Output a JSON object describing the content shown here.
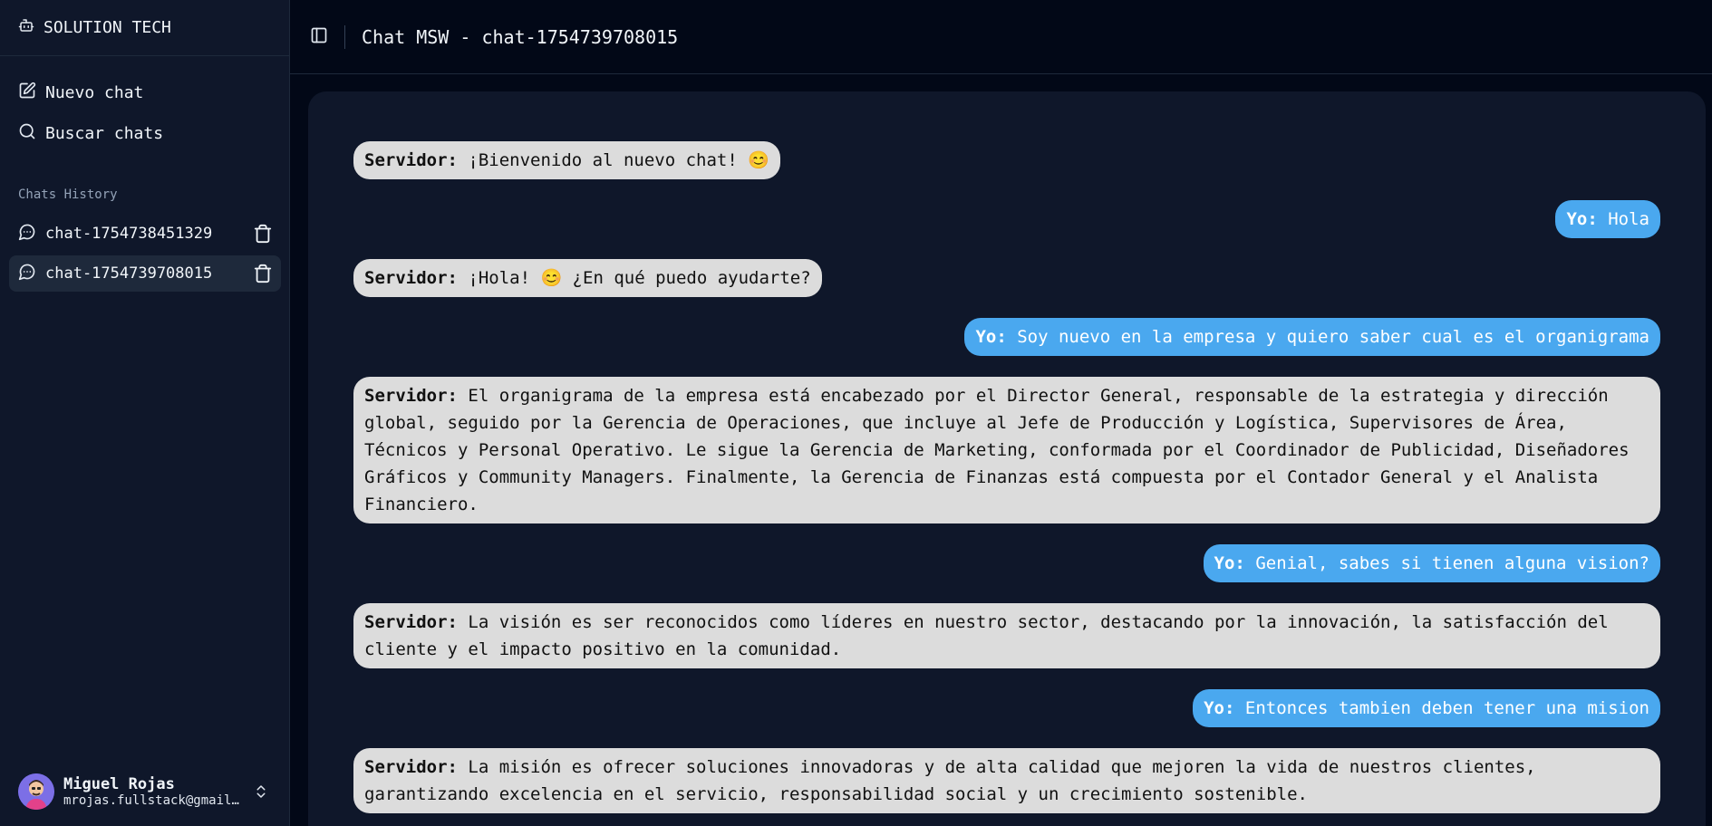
{
  "brand": {
    "name": "SOLUTION TECH",
    "icon": "bot-icon"
  },
  "nav": {
    "new_chat": "Nuevo chat",
    "search_chats": "Buscar chats"
  },
  "history": {
    "label": "Chats History",
    "items": [
      {
        "label": "chat-1754738451329",
        "active": false
      },
      {
        "label": "chat-1754739708015",
        "active": true
      }
    ]
  },
  "user": {
    "name": "Miguel Rojas",
    "email": "mrojas.fullstack@gmail.com"
  },
  "header": {
    "title": "Chat MSW - chat-1754739708015"
  },
  "messages": [
    {
      "from": "server",
      "speaker": "Servidor:",
      "text": " ¡Bienvenido al nuevo chat! 😊"
    },
    {
      "from": "me",
      "speaker": "Yo:",
      "text": " Hola"
    },
    {
      "from": "server",
      "speaker": "Servidor:",
      "text": " ¡Hola! 😊 ¿En qué puedo ayudarte?"
    },
    {
      "from": "me",
      "speaker": "Yo:",
      "text": " Soy nuevo en la empresa y quiero saber cual es el organigrama"
    },
    {
      "from": "server",
      "speaker": "Servidor:",
      "text": " El organigrama de la empresa está encabezado por el Director General, responsable de la estrategia y dirección global, seguido por la Gerencia de Operaciones, que incluye al Jefe de Producción y Logística, Supervisores de Área, Técnicos y Personal Operativo. Le sigue la Gerencia de Marketing, conformada por el Coordinador de Publicidad, Diseñadores Gráficos y Community Managers. Finalmente, la Gerencia de Finanzas está compuesta por el Contador General y el Analista Financiero."
    },
    {
      "from": "me",
      "speaker": "Yo:",
      "text": " Genial, sabes si tienen alguna vision?"
    },
    {
      "from": "server",
      "speaker": "Servidor:",
      "text": " La visión es ser reconocidos como líderes en nuestro sector, destacando por la innovación, la satisfacción del cliente y el impacto positivo en la comunidad."
    },
    {
      "from": "me",
      "speaker": "Yo:",
      "text": " Entonces tambien deben tener una mision"
    },
    {
      "from": "server",
      "speaker": "Servidor:",
      "text": " La misión es ofrecer soluciones innovadoras y de alta calidad que mejoren la vida de nuestros clientes, garantizando excelencia en el servicio, responsabilidad social y un crecimiento sostenible."
    }
  ],
  "colors": {
    "background": "#020817",
    "sidebar": "#0f172a",
    "server_bubble": "#dcdcdc",
    "user_bubble": "#4aa8ef"
  }
}
